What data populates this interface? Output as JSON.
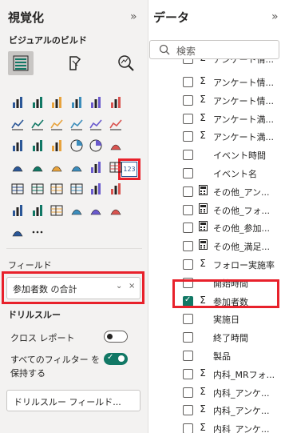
{
  "viz_pane": {
    "title": "視覚化",
    "collapse": "»",
    "subtitle": "ビジュアルのビルド",
    "field_section_label": "フィールド",
    "field_well_value": "参加者数 の合計",
    "drill_title": "ドリルスルー",
    "cross_report_label": "クロス レポート",
    "cross_report_on": false,
    "keep_filters_label": "すべてのフィルター を保持する",
    "keep_filters_on": true,
    "drill_field_placeholder": "ドリルスルー フィールド...",
    "selected_visual": "card-visual-icon",
    "visual_icons": [
      "stacked-bar-icon",
      "stacked-column-icon",
      "clustered-bar-icon",
      "clustered-column-icon",
      "100-bar-icon",
      "100-column-icon",
      "line-chart-icon",
      "area-chart-icon",
      "stacked-area-icon",
      "line-column-icon",
      "line-stacked-icon",
      "ribbon-icon",
      "waterfall-icon",
      "funnel-icon",
      "scatter-icon",
      "pie-icon",
      "donut-icon",
      "treemap-icon",
      "map-icon",
      "filled-map-icon",
      "shape-map-icon",
      "gauge-icon",
      "card-icon",
      "multirow-card-icon",
      "kpi-icon",
      "slicer-icon",
      "table-icon",
      "matrix-icon",
      "r-visual-icon",
      "python-icon",
      "decomposition-tree-icon",
      "qa-icon",
      "paginated-icon",
      "key-influencers-icon",
      "smart-narrative-icon",
      "power-apps-icon",
      "power-automate-icon",
      "more-icon"
    ]
  },
  "data_pane": {
    "title": "データ",
    "collapse": "»",
    "search_placeholder": "検索",
    "fields": [
      {
        "label": "アンケート情...",
        "icon": "Σ",
        "checked": false
      },
      {
        "label": "アンケート情...",
        "icon": "Σ",
        "checked": false
      },
      {
        "label": "アンケート満...",
        "icon": "Σ",
        "checked": false
      },
      {
        "label": "アンケート満...",
        "icon": "Σ",
        "checked": false
      },
      {
        "label": "イベント時間",
        "icon": "",
        "checked": false
      },
      {
        "label": "イベント名",
        "icon": "",
        "checked": false
      },
      {
        "label": "その他_アン...",
        "icon": "calc",
        "checked": false
      },
      {
        "label": "その他_フォ...",
        "icon": "calc",
        "checked": false
      },
      {
        "label": "その他_参加...",
        "icon": "calc",
        "checked": false
      },
      {
        "label": "その他_満足...",
        "icon": "calc",
        "checked": false
      },
      {
        "label": "フォロー実施率",
        "icon": "Σ",
        "checked": false
      },
      {
        "label": "開始時間",
        "icon": "",
        "checked": false
      },
      {
        "label": "参加者数",
        "icon": "Σ",
        "checked": true
      },
      {
        "label": "実施日",
        "icon": "",
        "checked": false
      },
      {
        "label": "終了時間",
        "icon": "",
        "checked": false
      },
      {
        "label": "製品",
        "icon": "",
        "checked": false
      },
      {
        "label": "内科_MRフォ...",
        "icon": "Σ",
        "checked": false
      },
      {
        "label": "内科_アンケ...",
        "icon": "Σ",
        "checked": false
      },
      {
        "label": "内科_アンケ...",
        "icon": "Σ",
        "checked": false
      },
      {
        "label": "内科_アンケ...",
        "icon": "Σ",
        "checked": false
      }
    ]
  }
}
